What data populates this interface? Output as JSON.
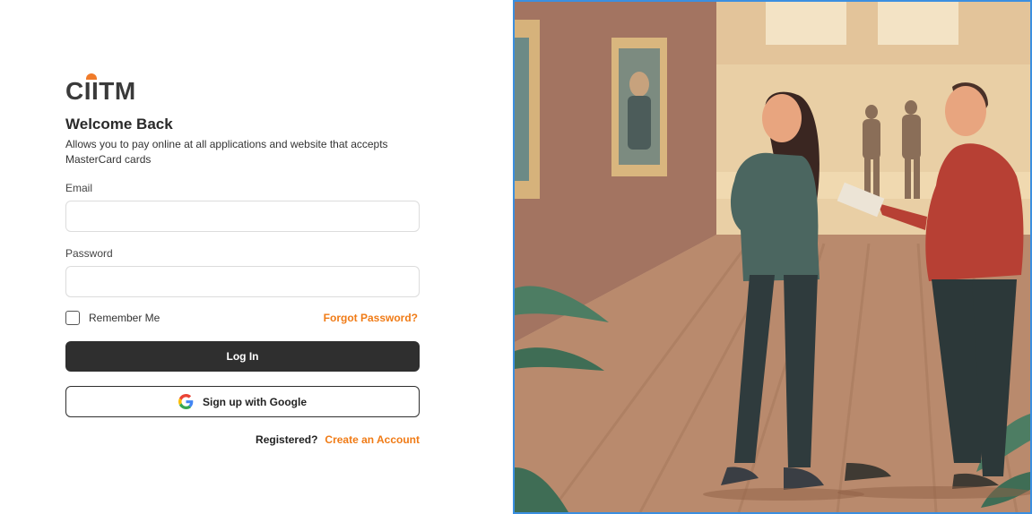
{
  "brand": {
    "logo_text": "CIITM",
    "accent_color": "#f07b16",
    "dark_color": "#2f2f2f"
  },
  "login": {
    "title": "Welcome Back",
    "subtitle": "Allows you to pay online at all applications and website that accepts MasterCard cards",
    "email_label": "Email",
    "email_value": "",
    "password_label": "Password",
    "password_value": "",
    "remember_label": "Remember Me",
    "remember_checked": false,
    "forgot_label": "Forgot Password?",
    "login_label": "Log In",
    "google_label": "Sign up with Google",
    "google_icon": "google-icon",
    "registered_label": "Registered?",
    "create_account_label": "Create an Account"
  },
  "illustration": {
    "alt": ""
  }
}
